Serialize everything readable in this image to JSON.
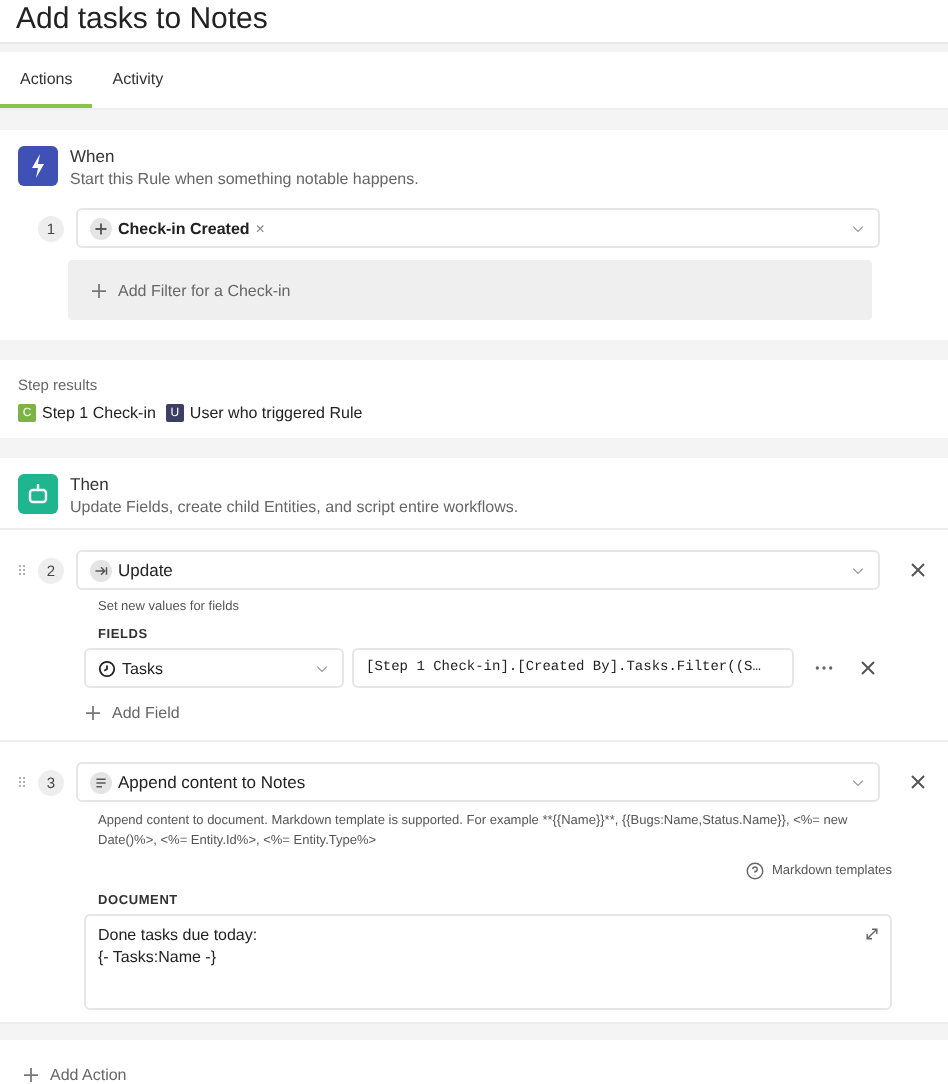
{
  "title": "Add tasks to Notes",
  "tabs": [
    {
      "label": "Actions",
      "selected": true
    },
    {
      "label": "Activity",
      "selected": false
    }
  ],
  "trigger": {
    "heading": "When",
    "description": "Start this Rule when something notable happens.",
    "step": "1",
    "chip": "Check-in Created",
    "remove": "×",
    "filter": "Add Filter for a Check-in"
  },
  "step_results": {
    "label": "Step results",
    "items": [
      {
        "badge": "C",
        "label": "Step 1 Check-in",
        "color": "#7cb342"
      },
      {
        "badge": "U",
        "label": "User who triggered Rule",
        "color": "#3c3f63"
      }
    ]
  },
  "then": {
    "heading": "Then",
    "description": "Update Fields, create child Entities, and script entire workflows."
  },
  "actions": [
    {
      "kind": "update",
      "step": "2",
      "title": "Update",
      "hint": "Set new values for fields",
      "fields_label": "FIELDS",
      "field": "Tasks",
      "value": "[Step 1 Check-in].[Created By].Tasks.Filter((S…",
      "add": "Add Field"
    },
    {
      "kind": "append",
      "step": "3",
      "title": "Append content to Notes",
      "hint": "Append content to document. Markdown template is supported. For example **{{Name}}**, {{Bugs:Name,Status.Name}}, <%= new Date()%>, <%= Entity.Id%>, <%= Entity.Type%>",
      "link": "Markdown templates",
      "doc_label": "DOCUMENT",
      "doc_lines": [
        "Done tasks due today:",
        "{- Tasks:Name -}"
      ]
    }
  ],
  "add_action": "Add Action"
}
